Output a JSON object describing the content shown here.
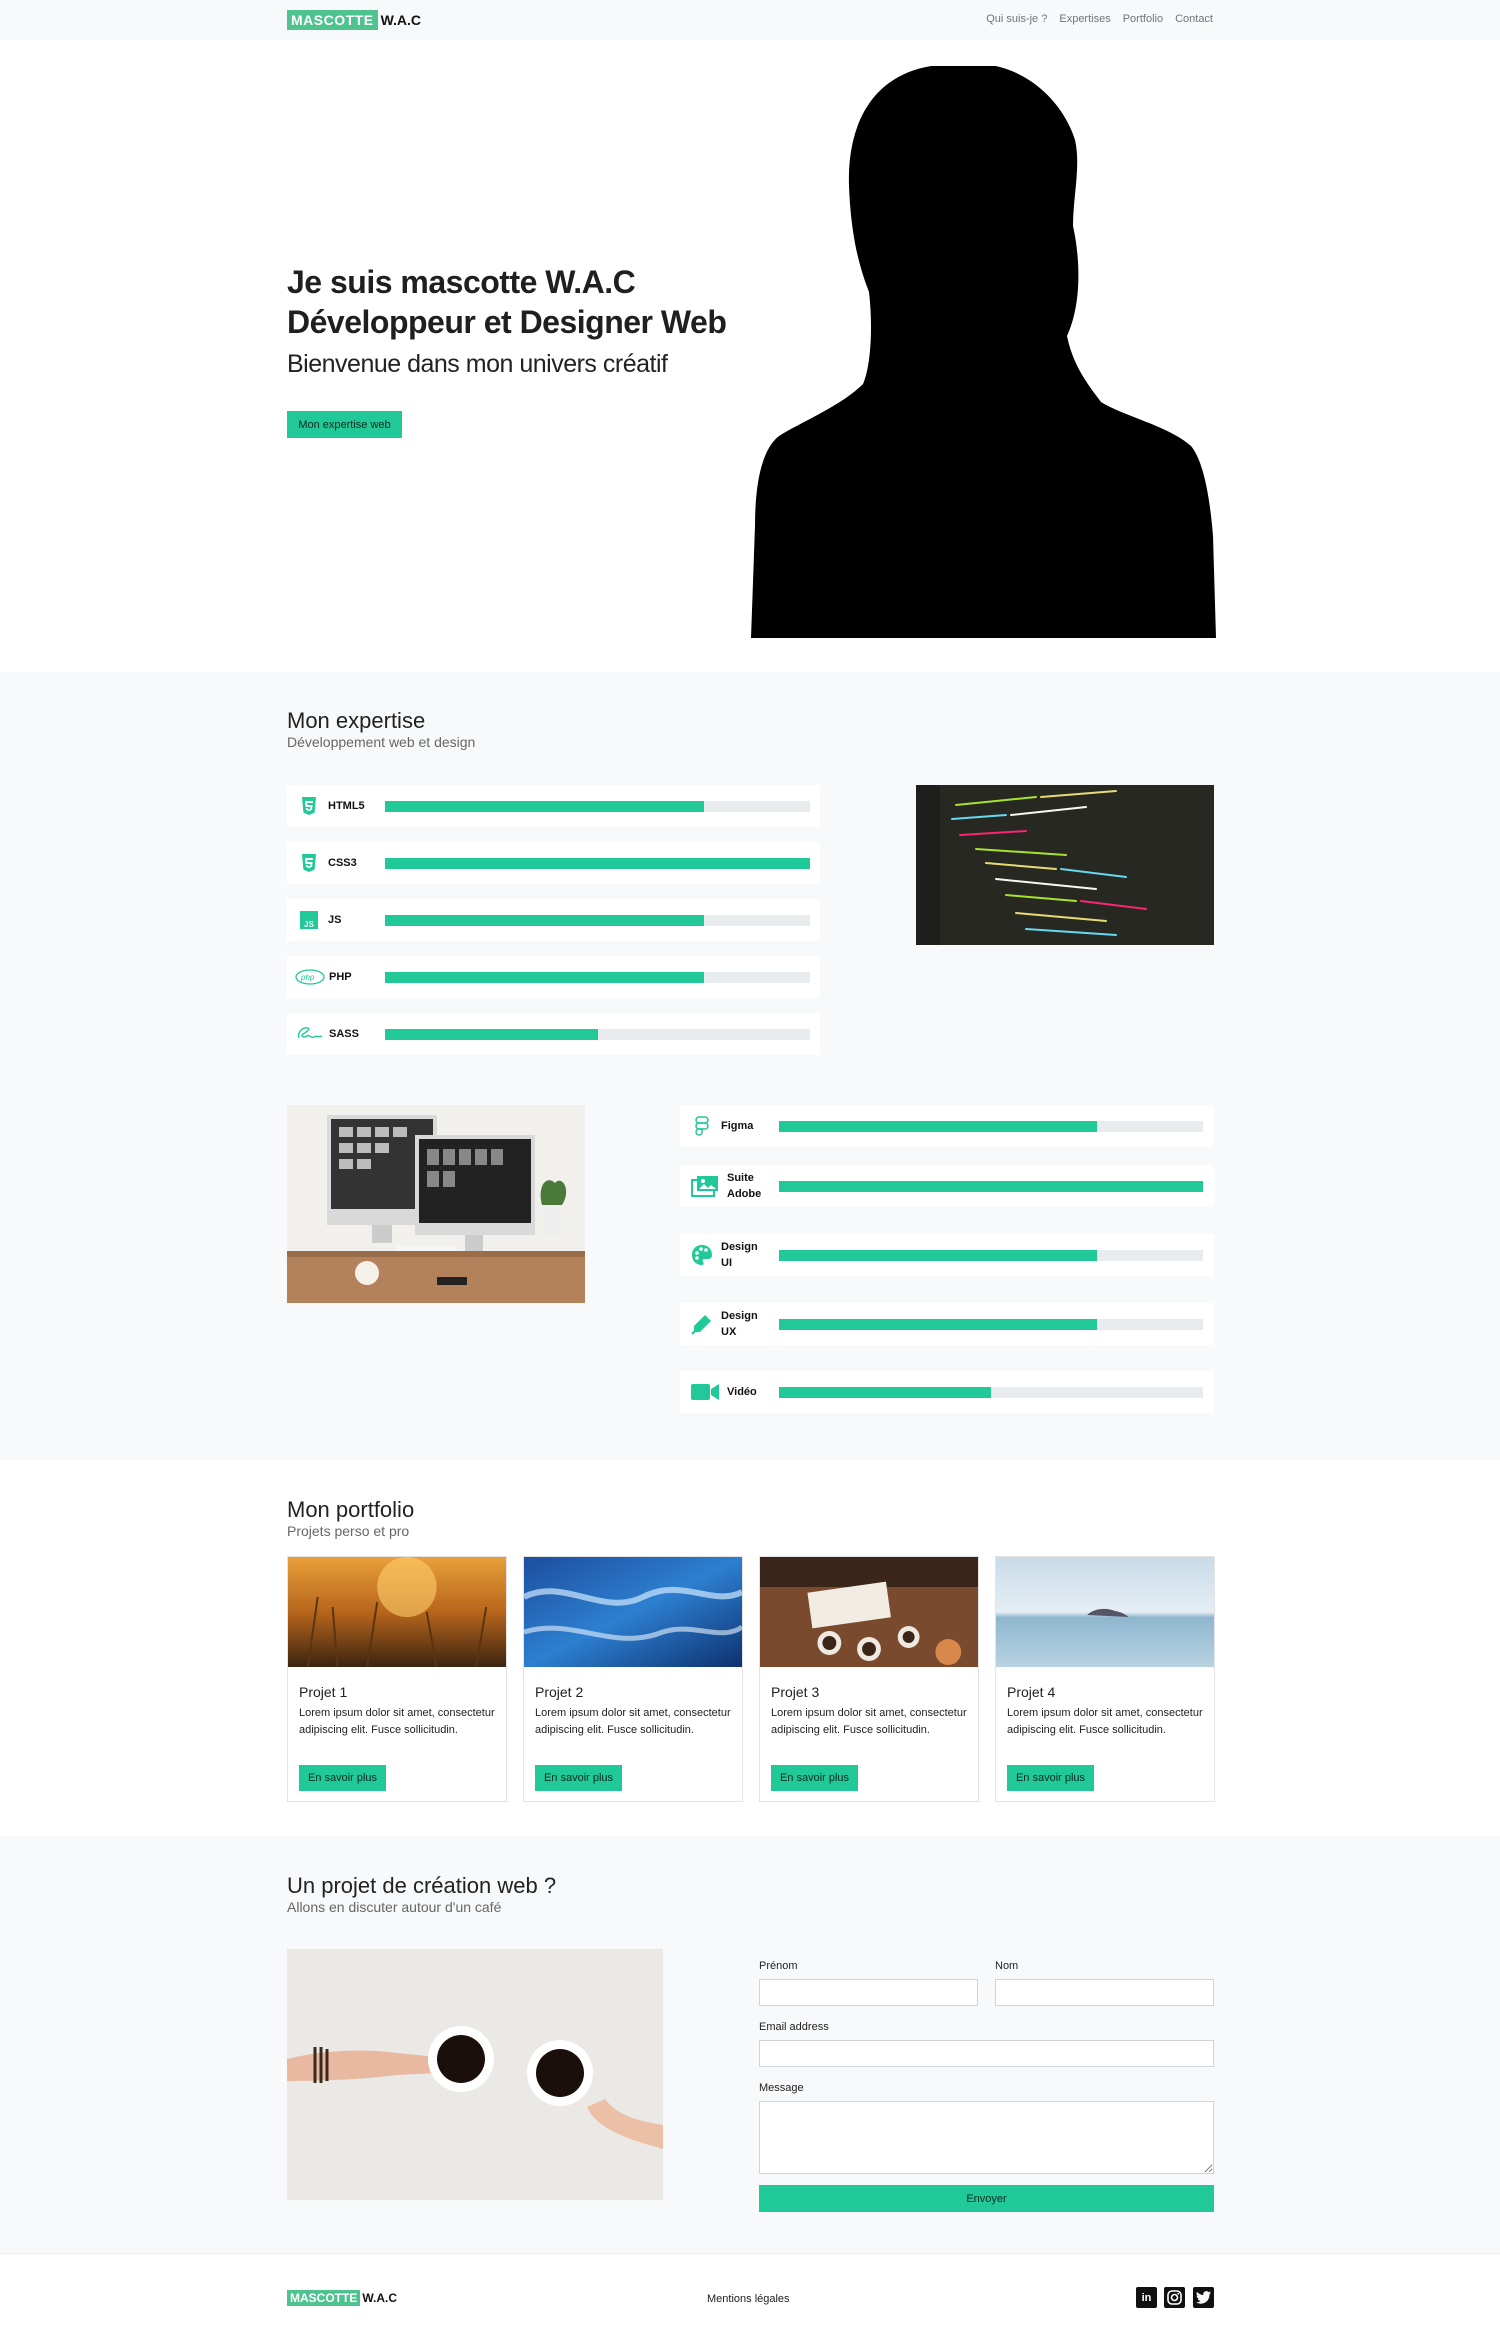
{
  "navbar": {
    "brand_box": "MASCOTTE",
    "brand_text": "W.A.C",
    "links": [
      "Qui suis-je ?",
      "Expertises",
      "Portfolio",
      "Contact"
    ]
  },
  "hero": {
    "title_line1": "Je suis mascotte W.A.C",
    "title_line2": "Développeur et Designer Web",
    "subtitle": "Bienvenue dans mon univers créatif",
    "button": "Mon expertise web"
  },
  "expertise": {
    "title": "Mon expertise",
    "subtitle": "Développement web et design",
    "dev_skills": [
      {
        "label": "HTML5",
        "icon": "html5-icon",
        "level": 0.75
      },
      {
        "label": "CSS3",
        "icon": "css3-icon",
        "level": 1.0
      },
      {
        "label": "JS",
        "icon": "js-icon",
        "level": 0.75
      },
      {
        "label": "PHP",
        "icon": "php-icon",
        "level": 0.75
      },
      {
        "label": "SASS",
        "icon": "sass-icon",
        "level": 0.5
      }
    ],
    "design_skills": [
      {
        "label_1": "Figma",
        "label_2": "",
        "icon": "figma-icon",
        "level": 0.75
      },
      {
        "label_1": "Suite",
        "label_2": "Adobe",
        "icon": "image-icon",
        "level": 1.0
      },
      {
        "label_1": "Design",
        "label_2": "UI",
        "icon": "palette-icon",
        "level": 0.75
      },
      {
        "label_1": "Design",
        "label_2": "UX",
        "icon": "pen-icon",
        "level": 0.75
      },
      {
        "label_1": "Vidéo",
        "label_2": "",
        "icon": "video-icon",
        "level": 0.5
      }
    ]
  },
  "portfolio": {
    "title": "Mon portfolio",
    "subtitle": "Projets perso et pro",
    "projects": [
      {
        "title": "Projet 1",
        "text": "Lorem ipsum dolor sit amet, consectetur adipiscing elit. Fusce sollicitudin.",
        "button": "En savoir plus"
      },
      {
        "title": "Projet 2",
        "text": "Lorem ipsum dolor sit amet, consectetur adipiscing elit. Fusce sollicitudin.",
        "button": "En savoir plus"
      },
      {
        "title": "Projet 3",
        "text": "Lorem ipsum dolor sit amet, consectetur adipiscing elit. Fusce sollicitudin.",
        "button": "En savoir plus"
      },
      {
        "title": "Projet 4",
        "text": "Lorem ipsum dolor sit amet, consectetur adipiscing elit. Fusce sollicitudin.",
        "button": "En savoir plus"
      }
    ]
  },
  "contact": {
    "title": "Un projet de création web ?",
    "subtitle": "Allons en discuter autour d'un café",
    "firstname_label": "Prénom",
    "lastname_label": "Nom",
    "email_label": "Email address",
    "message_label": "Message",
    "submit": "Envoyer"
  },
  "footer": {
    "brand_box": "MASCOTTE",
    "brand_text": "W.A.C",
    "mentions": "Mentions légales",
    "social": [
      "linkedin-icon",
      "instagram-icon",
      "twitter-icon"
    ]
  },
  "colors": {
    "accent": "#20c997",
    "brand": "#4fc38f",
    "section_bg": "#f8f9fa"
  }
}
